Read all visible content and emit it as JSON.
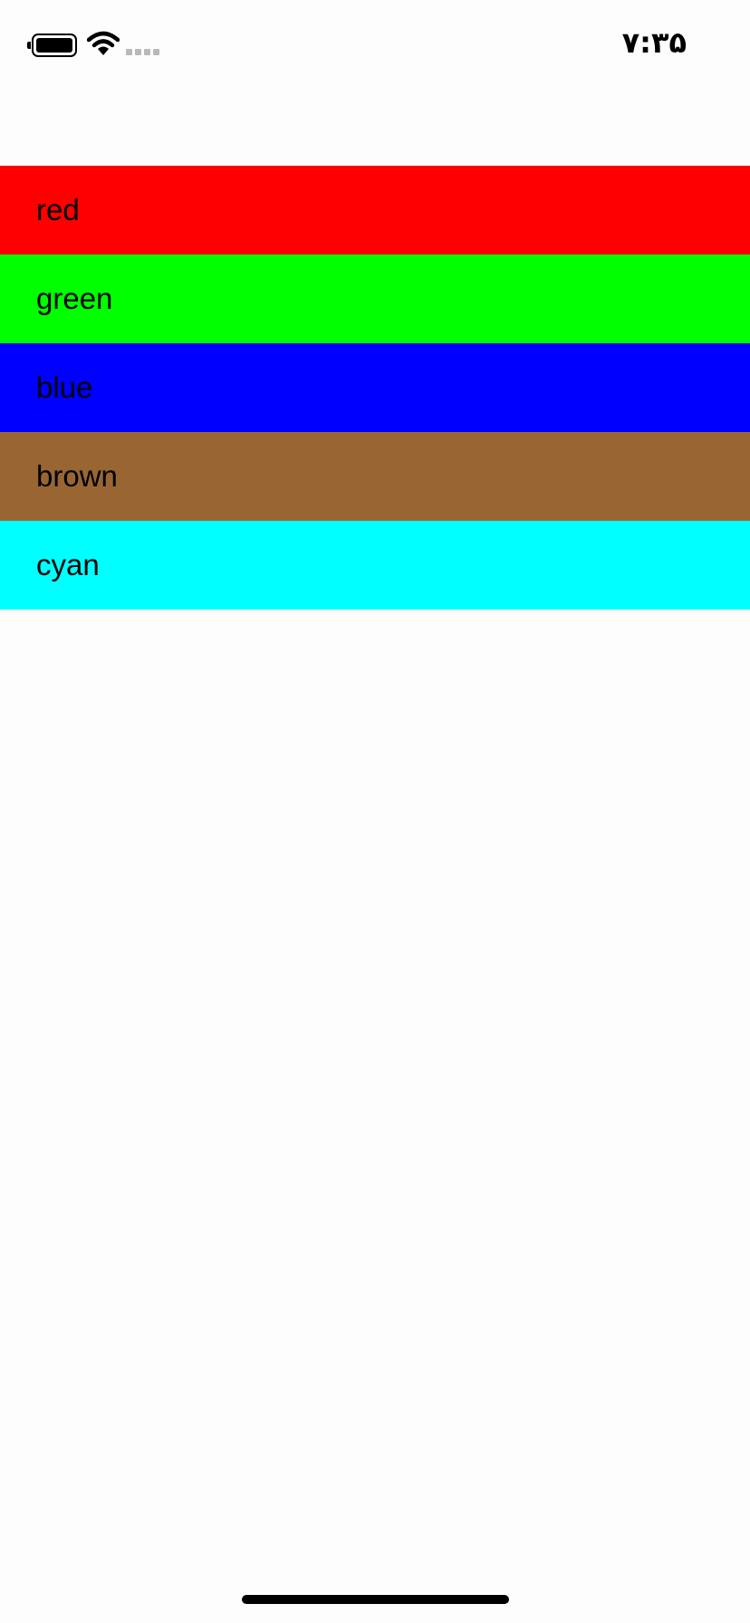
{
  "status_bar": {
    "time": "۷:۳۵",
    "battery_icon": "battery-full-icon",
    "wifi_icon": "wifi-icon",
    "signal_icon": "cellular-signal-icon"
  },
  "color_list": {
    "items": [
      {
        "label": "red",
        "color": "#ff0000"
      },
      {
        "label": "green",
        "color": "#00ff00"
      },
      {
        "label": "blue",
        "color": "#0000ff"
      },
      {
        "label": "brown",
        "color": "#996633"
      },
      {
        "label": "cyan",
        "color": "#00ffff"
      }
    ]
  }
}
